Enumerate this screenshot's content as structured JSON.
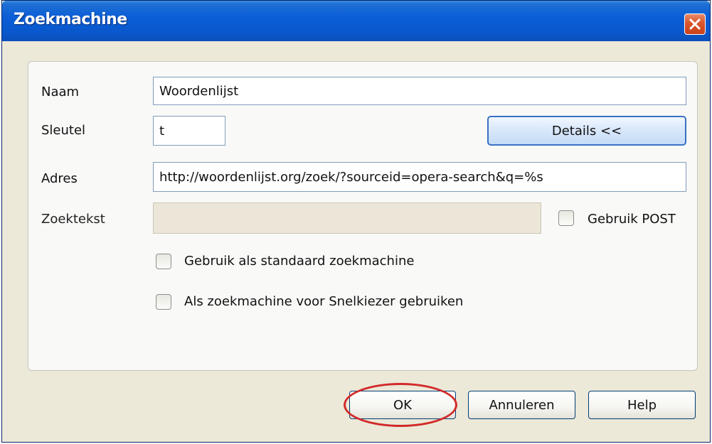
{
  "window": {
    "title": "Zoekmachine",
    "close_icon": "close-icon"
  },
  "form": {
    "name_label": "Naam",
    "name_value": "Woordenlijst",
    "key_label": "Sleutel",
    "key_value": "t",
    "details_button": "Details <<",
    "address_label": "Adres",
    "address_value": "http://woordenlijst.org/zoek/?sourceid=opera-search&q=%s",
    "query_label": "Zoektekst",
    "query_value": "",
    "use_post_label": "Gebruik POST",
    "use_post_checked": false,
    "default_engine_label": "Gebruik als standaard zoekmachine",
    "default_engine_checked": false,
    "speed_dial_label": "Als zoekmachine voor Snelkiezer gebruiken",
    "speed_dial_checked": false
  },
  "footer": {
    "ok_label": "OK",
    "cancel_label": "Annuleren",
    "help_label": "Help"
  },
  "colors": {
    "titlebar": "#0b5ed7",
    "close_button": "#d9552b",
    "highlight_circle": "#d22a2a"
  }
}
